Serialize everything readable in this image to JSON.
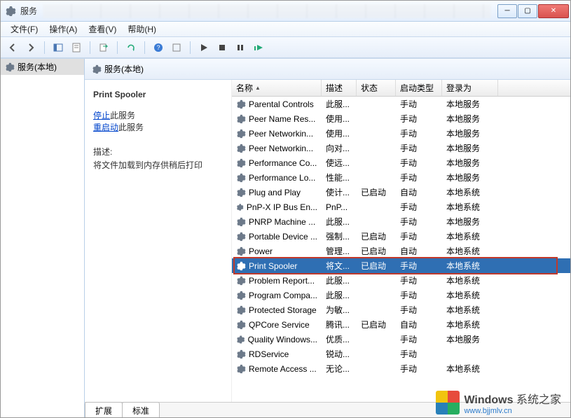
{
  "title": "服务",
  "menus": {
    "file": "文件(F)",
    "action": "操作(A)",
    "view": "查看(V)",
    "help": "帮助(H)"
  },
  "tree": {
    "root": "服务(本地)"
  },
  "header": {
    "title": "服务(本地)"
  },
  "detail": {
    "name": "Print Spooler",
    "stop": "停止",
    "stop_suffix": "此服务",
    "restart": "重启动",
    "restart_suffix": "此服务",
    "desc_label": "描述:",
    "desc_text": "将文件加载到内存供稍后打印"
  },
  "columns": {
    "name": "名称",
    "desc": "描述",
    "state": "状态",
    "start": "启动类型",
    "logon": "登录为"
  },
  "tabs": {
    "ext": "扩展",
    "std": "标准"
  },
  "watermark": {
    "brand": "Windows",
    "suffix": "系统之家",
    "url": "www.bjjmlv.cn"
  },
  "services": [
    {
      "name": "Parental Controls",
      "desc": "此服...",
      "state": "",
      "start": "手动",
      "logon": "本地服务"
    },
    {
      "name": "Peer Name Res...",
      "desc": "使用...",
      "state": "",
      "start": "手动",
      "logon": "本地服务"
    },
    {
      "name": "Peer Networkin...",
      "desc": "使用...",
      "state": "",
      "start": "手动",
      "logon": "本地服务"
    },
    {
      "name": "Peer Networkin...",
      "desc": "向对...",
      "state": "",
      "start": "手动",
      "logon": "本地服务"
    },
    {
      "name": "Performance Co...",
      "desc": "使远...",
      "state": "",
      "start": "手动",
      "logon": "本地服务"
    },
    {
      "name": "Performance Lo...",
      "desc": "性能...",
      "state": "",
      "start": "手动",
      "logon": "本地服务"
    },
    {
      "name": "Plug and Play",
      "desc": "使计...",
      "state": "已启动",
      "start": "自动",
      "logon": "本地系统"
    },
    {
      "name": "PnP-X IP Bus En...",
      "desc": "PnP...",
      "state": "",
      "start": "手动",
      "logon": "本地系统"
    },
    {
      "name": "PNRP Machine ...",
      "desc": "此服...",
      "state": "",
      "start": "手动",
      "logon": "本地服务"
    },
    {
      "name": "Portable Device ...",
      "desc": "强制...",
      "state": "已启动",
      "start": "手动",
      "logon": "本地系统"
    },
    {
      "name": "Power",
      "desc": "管理...",
      "state": "已启动",
      "start": "自动",
      "logon": "本地系统"
    },
    {
      "name": "Print Spooler",
      "desc": "将文...",
      "state": "已启动",
      "start": "手动",
      "logon": "本地系统",
      "selected": true
    },
    {
      "name": "Problem Report...",
      "desc": "此服...",
      "state": "",
      "start": "手动",
      "logon": "本地系统"
    },
    {
      "name": "Program Compa...",
      "desc": "此服...",
      "state": "",
      "start": "手动",
      "logon": "本地系统"
    },
    {
      "name": "Protected Storage",
      "desc": "为敏...",
      "state": "",
      "start": "手动",
      "logon": "本地系统"
    },
    {
      "name": "QPCore Service",
      "desc": "腾讯...",
      "state": "已启动",
      "start": "自动",
      "logon": "本地系统"
    },
    {
      "name": "Quality Windows...",
      "desc": "优质...",
      "state": "",
      "start": "手动",
      "logon": "本地服务"
    },
    {
      "name": "RDService",
      "desc": "锐动...",
      "state": "",
      "start": "手动",
      "logon": ""
    },
    {
      "name": "Remote Access ...",
      "desc": "无论...",
      "state": "",
      "start": "手动",
      "logon": "本地系统"
    }
  ]
}
